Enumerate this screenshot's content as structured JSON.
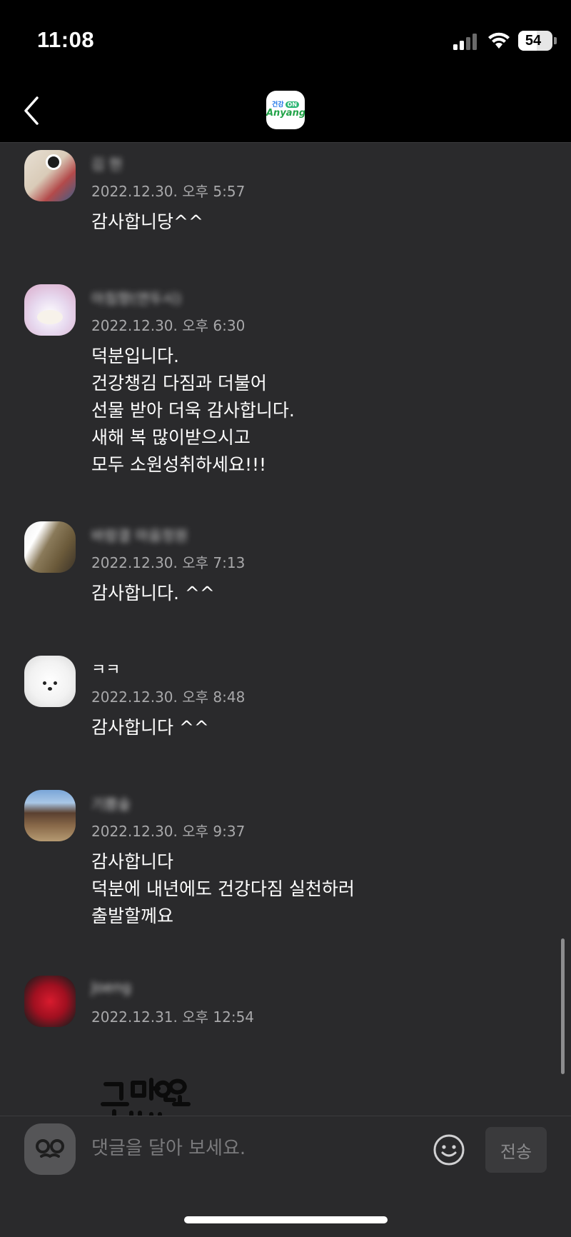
{
  "status_bar": {
    "time": "11:08",
    "battery": "54",
    "battery_level": 0.54
  },
  "comment_input": {
    "placeholder": "댓글을 달아 보세요.",
    "send_label": "전송"
  },
  "comments": [
    {
      "author": "김 현",
      "date": "2022.12.30. 오후 5:57",
      "text": "감사합니당^^"
    },
    {
      "author": "아침향(연두시)",
      "date": "2022.12.30. 오후 6:30",
      "text": "덕분입니다.\n건강챙김 다짐과 더불어\n선물 받아 더욱 감사합니다.\n새해 복 많이받으시고\n모두 소원성취하세요!!!"
    },
    {
      "author": "바람결 마음정원",
      "date": "2022.12.30. 오후 7:13",
      "text": "감사합니다. ^^"
    },
    {
      "author": "ㅋㅋ",
      "date": "2022.12.30. 오후 8:48",
      "text": "감사합니다 ^^"
    },
    {
      "author": "기쁨숲",
      "date": "2022.12.30. 오후 9:37",
      "text": "감사합니다\n덕분에 내년에도 건강다짐 실천하러\n출발할께요"
    },
    {
      "author": "Joeng",
      "date": "2022.12.31. 오후 12:54",
      "text": ""
    }
  ],
  "sticker_text": "고마워요 덕분에",
  "colors": {
    "background": "#2a2a2c",
    "bar": "#000000",
    "date_text": "#a8a8aa"
  }
}
